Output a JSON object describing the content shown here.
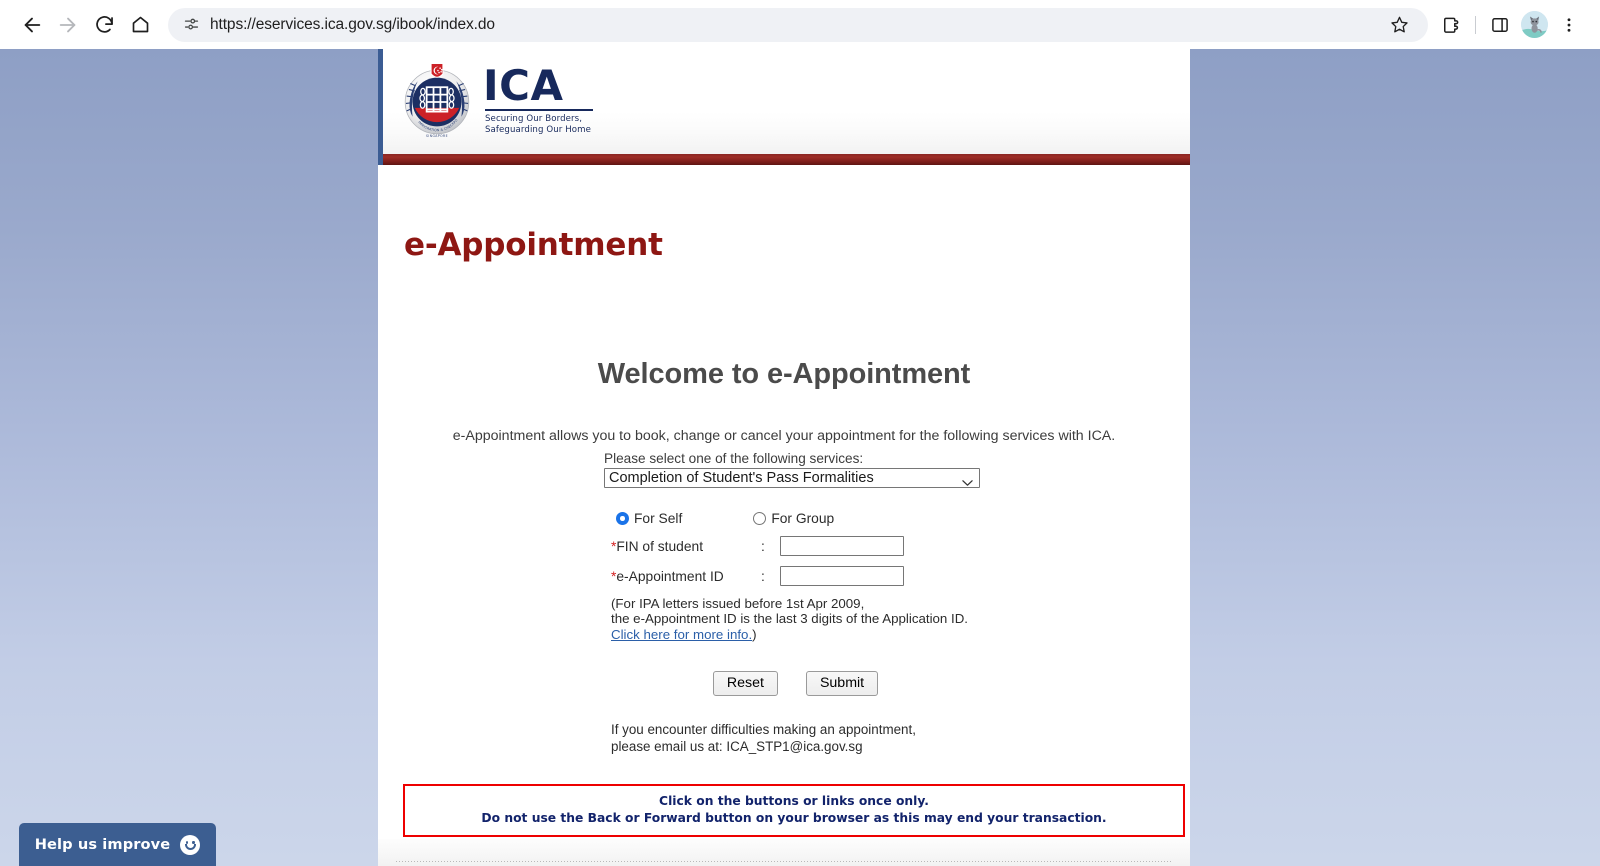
{
  "browser": {
    "url": "https://eservices.ica.gov.sg/ibook/index.do",
    "back_label": "Back",
    "forward_label": "Forward",
    "reload_label": "Reload",
    "home_label": "Home",
    "site_info_label": "View site information",
    "bookmark_label": "Bookmark this tab",
    "extensions_label": "Extensions",
    "side_panel_label": "Side panel",
    "profile_label": "Profile",
    "menu_label": "Customize and control Google Chrome"
  },
  "site": {
    "logo_letters": "ICA",
    "logo_tagline_line1": "Securing Our Borders,",
    "logo_tagline_line2": "Safeguarding Our Home",
    "app_title": "e-Appointment",
    "welcome_heading": "Welcome to e-Appointment",
    "intro": "e-Appointment allows you to book, change or cancel your appointment for the following services with ICA.",
    "service_select": {
      "label": "Please select one of the following services:",
      "value": "Completion of Student's Pass Formalities",
      "options": [
        "Completion of Student's Pass Formalities"
      ]
    },
    "radios": [
      {
        "label": "For Self",
        "selected": true
      },
      {
        "label": "For Group",
        "selected": false
      }
    ],
    "fields": [
      {
        "star": "*",
        "label": "FIN of student",
        "colon": ":",
        "value": "",
        "placeholder": ""
      },
      {
        "star": "*",
        "label": "e-Appointment ID",
        "colon": ":",
        "value": "",
        "placeholder": ""
      }
    ],
    "ipa_note_line1": "(For IPA letters issued before 1st Apr 2009,",
    "ipa_note_line2": "the e-Appointment ID is the last 3 digits of the Application ID.",
    "ipa_link_text": "Click here for more info.",
    "ipa_note_close": ")",
    "buttons": {
      "reset": "Reset",
      "submit": "Submit"
    },
    "contact_line1": "If you encounter difficulties making an appointment,",
    "contact_line2": "please email us at: ICA_STP1@ica.gov.sg",
    "warning_line1": "Click on the buttons or links once only.",
    "warning_line2": "Do not use the Back or Forward button on your browser as this may end your transaction."
  },
  "help_widget": {
    "label": "Help us improve",
    "icon": "smiley-icon"
  },
  "colors": {
    "accent_red": "#8e1713",
    "bar_red": "#8a2622",
    "warning_border": "#ee0000",
    "warning_text": "#12236b",
    "brand_navy": "#17295c",
    "help_blue": "#3c5e91",
    "radio_blue": "#1a73e8",
    "link_blue": "#2b5fa8",
    "bg_top": "#8e9fc5",
    "bg_bottom": "#ccd6ea"
  }
}
